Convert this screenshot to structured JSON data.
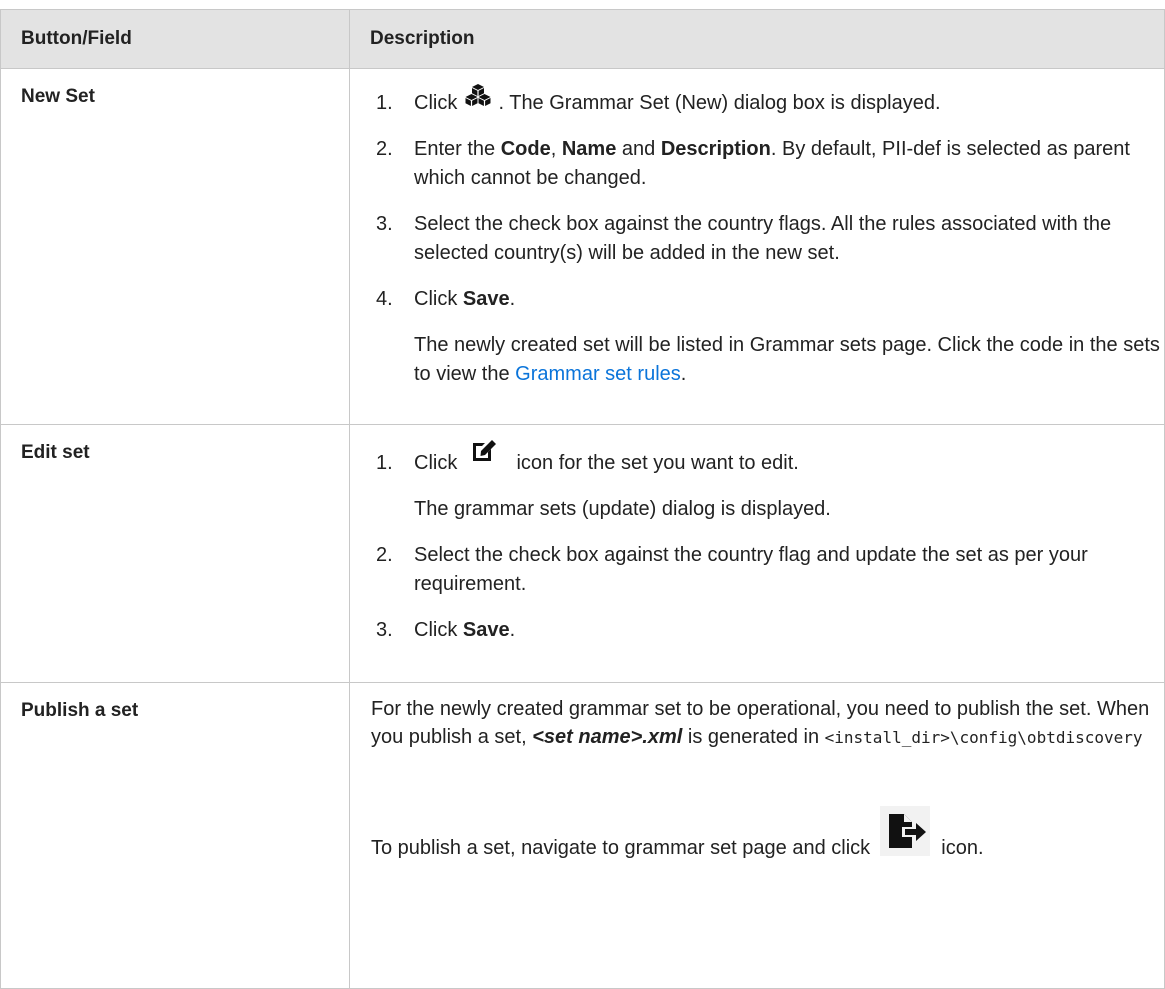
{
  "headers": {
    "col1": "Button/Field",
    "col2": "Description"
  },
  "new_set": {
    "field": "New Set",
    "s1_num": "1.",
    "s1_a": "Click",
    "s1_b": ". The Grammar Set (New) dialog box is displayed.",
    "s2_num": "2.",
    "s2_a": "Enter the",
    "s2_code": "Code",
    "s2_sep1": ",",
    "s2_name": "Name",
    "s2_and": "and",
    "s2_desc": "Description",
    "s2_b": ". By default, PII-def is selected as parent which cannot be changed.",
    "s3_num": "3.",
    "s3": "Select the check box against the country flags. All the rules associated with the selected country(s) will be added in the new set.",
    "s4_num": "4.",
    "s4_a": "Click",
    "s4_save": "Save",
    "s4_dot": ".",
    "note_a": "The newly created set will be listed in Grammar sets page. Click the code in the sets to view the",
    "note_link": "Grammar set rules",
    "note_dot": ".",
    "icon": "cubes-icon"
  },
  "edit_set": {
    "field": "Edit set",
    "s1_num": "1.",
    "s1_a": "Click",
    "s1_b": "icon for the set you want to edit.",
    "s1_note": "The grammar sets (update) dialog is displayed.",
    "s2_num": "2.",
    "s2": "Select the check box against the country flag and update the set as per your requirement.",
    "s3_num": "3.",
    "s3_a": "Click",
    "s3_save": "Save",
    "s3_dot": ".",
    "icon": "edit-icon"
  },
  "publish_set": {
    "field": "Publish a set",
    "p1_a": "For the newly created grammar set to be operational, you need to publish the set. When you publish a set,",
    "p1_file": "<set name>.xml",
    "p1_b": "is generated in",
    "p1_path": "<install_dir>\\config\\obtdiscovery",
    "p2_a": "To publish a set, navigate to grammar set page and click",
    "p2_b": "icon.",
    "icon": "publish-icon"
  }
}
